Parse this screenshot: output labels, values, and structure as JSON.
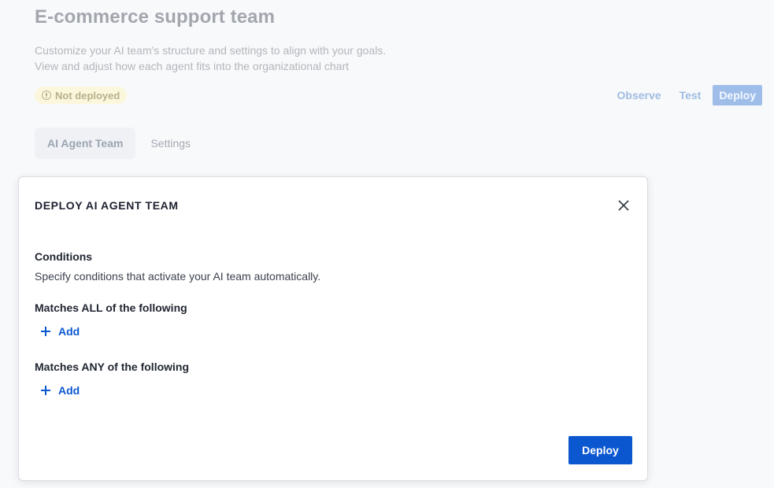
{
  "header": {
    "title": "E-commerce support team",
    "description_line1": "Customize your AI team's structure and settings to align with your goals.",
    "description_line2": "View and adjust how each agent fits into the organizational chart",
    "status": "Not deployed",
    "status_icon": "info-icon"
  },
  "actions": {
    "observe": "Observe",
    "test": "Test",
    "deploy": "Deploy"
  },
  "tabs": [
    {
      "label": "AI Agent Team",
      "active": true
    },
    {
      "label": "Settings",
      "active": false
    }
  ],
  "modal": {
    "title": "DEPLOY AI AGENT TEAM",
    "close_icon": "close-icon",
    "conditions_title": "Conditions",
    "conditions_desc": "Specify conditions that activate your AI team automatically.",
    "match_all": {
      "prefix": "Matches ",
      "emphasis": "ALL",
      "suffix": " of the following",
      "add_label": "Add"
    },
    "match_any": {
      "prefix": "Matches ",
      "emphasis": "ANY",
      "suffix": " of the following",
      "add_label": "Add"
    },
    "deploy_label": "Deploy"
  },
  "colors": {
    "primary": "#0b57d0",
    "badge_bg": "#fbf7dc"
  }
}
